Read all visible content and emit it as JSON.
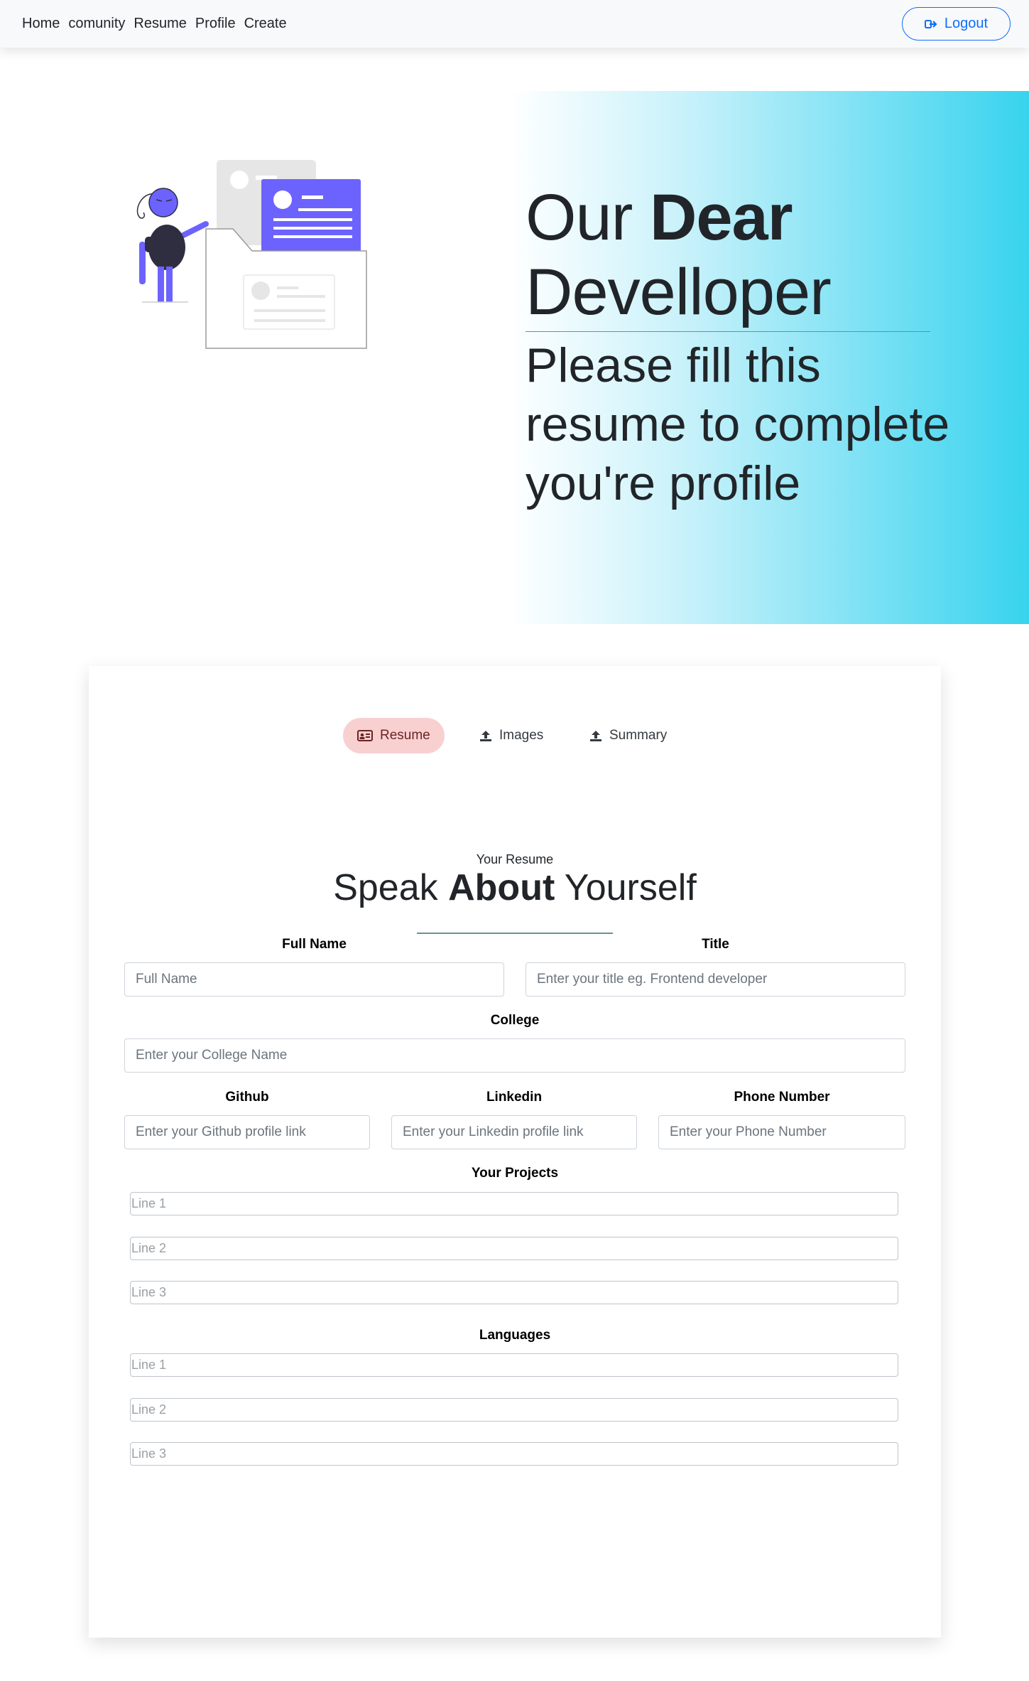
{
  "nav": {
    "links": [
      "Home",
      "comunity",
      "Resume",
      "Profile",
      "Create"
    ],
    "logout_label": "Logout"
  },
  "hero": {
    "title_light": "Our",
    "title_bold": "Dear",
    "title_line2": "Develloper",
    "subtitle": "Please fill this resume to complete you're profile"
  },
  "tabs": {
    "resume": "Resume",
    "images": "Images",
    "summary": "Summary"
  },
  "resume": {
    "label": "Your Resume",
    "heading_pre": "Speak",
    "heading_bold": "About",
    "heading_post": "Yourself"
  },
  "form": {
    "full_name": {
      "label": "Full Name",
      "placeholder": "Full Name"
    },
    "title": {
      "label": "Title",
      "placeholder": "Enter your title eg. Frontend developer"
    },
    "college": {
      "label": "College",
      "placeholder": "Enter your College Name"
    },
    "github": {
      "label": "Github",
      "placeholder": "Enter your Github profile link"
    },
    "linkedin": {
      "label": "Linkedin",
      "placeholder": "Enter your Linkedin profile link"
    },
    "phone": {
      "label": "Phone Number",
      "placeholder": "Enter your Phone Number"
    },
    "projects": {
      "label": "Your Projects",
      "lines": [
        "Line 1",
        "Line 2",
        "Line 3"
      ]
    },
    "languages": {
      "label": "Languages",
      "lines": [
        "Line 1",
        "Line 2",
        "Line 3"
      ]
    }
  },
  "colors": {
    "accent_blue": "#0d6efd",
    "hero_cyan": "#38d3ee",
    "illustration_purple": "#6c63ff",
    "active_tab_bg": "#f8d0d0"
  }
}
